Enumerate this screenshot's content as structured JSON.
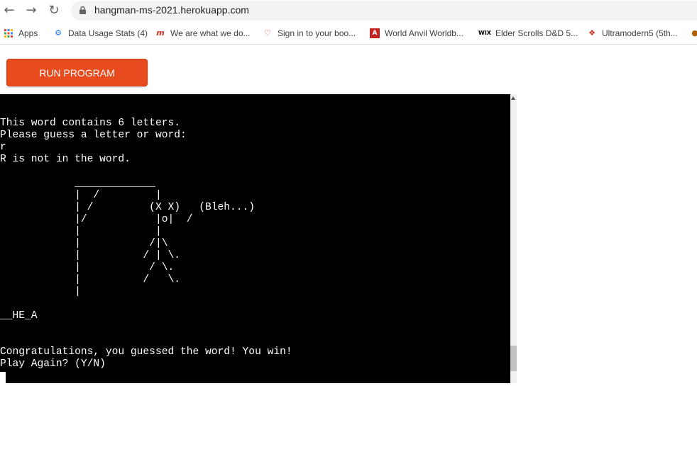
{
  "browser": {
    "url": "hangman-ms-2021.herokuapp.com",
    "bookmarks": [
      {
        "label": "Apps",
        "icon": "apps-grid-icon",
        "color": "#1a73e8"
      },
      {
        "label": "Data Usage Stats (4)",
        "icon": "data-usage-icon",
        "color": "#1a73e8"
      },
      {
        "label": "We are what we do...",
        "icon": "m-logo-icon",
        "color": "#d93025"
      },
      {
        "label": "Sign in to your boo...",
        "icon": "heart-icon",
        "color": "#d93025"
      },
      {
        "label": "World Anvil Worldb...",
        "icon": "anvil-icon",
        "color": "#c5221f"
      },
      {
        "label": "Elder Scrolls D&D 5...",
        "icon": "wix-icon",
        "color": "#000000"
      },
      {
        "label": "Ultramodern5 (5th...",
        "icon": "bookmark-logo-icon",
        "color": "#d93025"
      }
    ]
  },
  "run_button": {
    "label": "RUN PROGRAM"
  },
  "terminal": {
    "output": "This word contains 6 letters.\nPlease guess a letter or word:\nr\nR is not in the word.\n\n            _____________\n            |  /         |\n            | /         (X X)   (Bleh...)\n            |/           |o|  /\n            |            |\n            |           /|\\\n            |          / | \\.\n            |           / \\.\n            |          /   \\.\n            |\n\n__HE_A\n\n\nCongratulations, you guessed the word! You win!\nPlay Again? (Y/N)"
  }
}
